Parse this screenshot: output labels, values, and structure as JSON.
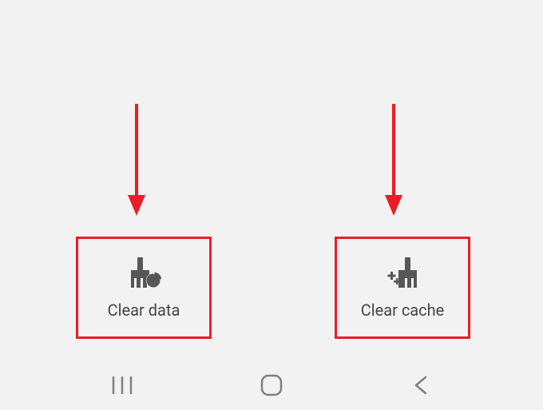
{
  "buttons": {
    "clear_data": {
      "label": "Clear data"
    },
    "clear_cache": {
      "label": "Clear cache"
    }
  },
  "annotation_color": "#ed1c24",
  "icon_color": "#575757",
  "nav_icon_color": "#808080"
}
